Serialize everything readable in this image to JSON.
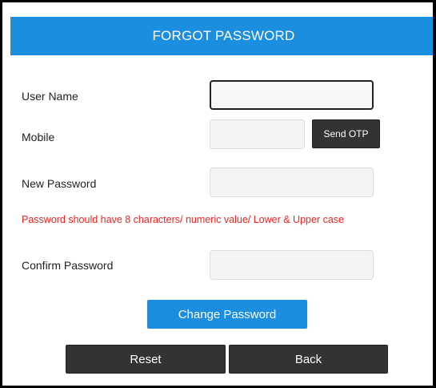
{
  "header": {
    "title": "FORGOT PASSWORD"
  },
  "form": {
    "username": {
      "label": "User Name",
      "value": ""
    },
    "mobile": {
      "label": "Mobile",
      "value": ""
    },
    "send_otp_label": "Send OTP",
    "new_password": {
      "label": "New Password",
      "value": ""
    },
    "hint": "Password should have 8 characters/ numeric value/ Lower & Upper case",
    "confirm_password": {
      "label": "Confirm Password",
      "value": ""
    }
  },
  "actions": {
    "change_password_label": "Change Password",
    "reset_label": "Reset",
    "back_label": "Back"
  },
  "colors": {
    "accent": "#1c8ee0",
    "dark_button": "#333333",
    "hint_text": "#ee2222"
  }
}
